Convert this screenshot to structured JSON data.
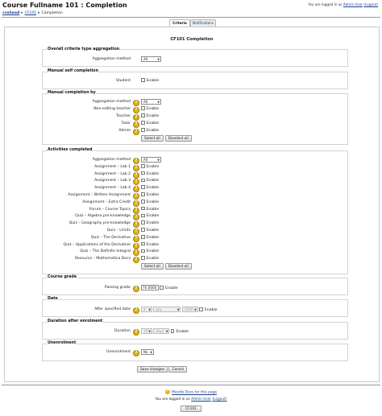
{
  "header": {
    "title": "Course Fullname 101 : Completion",
    "login_prefix": "You are logged in as",
    "login_user": "Admin User",
    "logout": "(Logout)"
  },
  "breadcrumb": [
    "cvshead",
    "CF101",
    "Completion"
  ],
  "tabs": [
    "Criteria",
    "Notifications"
  ],
  "page_title": "CF101 Completion",
  "sections": {
    "aggregation": {
      "legend": "Overall criteria type aggregation",
      "method_label": "Aggregation method",
      "method_value": "All"
    },
    "self": {
      "legend": "Manual self completion",
      "student_label": "Student",
      "enable": "Enable"
    },
    "manual": {
      "legend": "Manual completion by",
      "method_label": "Aggregation method",
      "method_value": "All",
      "roles": [
        "Non-editing teacher",
        "Teacher",
        "Tutor",
        "Admin"
      ],
      "enable": "Enable",
      "select_all": "Select all",
      "deselect_all": "Deselect all"
    },
    "activities": {
      "legend": "Activities completed",
      "method_label": "Aggregation method",
      "method_value": "All",
      "items": [
        "Assignment – Lab 1",
        "Assignment – Lab 2",
        "Assignment – Lab 3",
        "Assignment – Lab 4",
        "Assignment – Written Assignment",
        "Assignment – Extra Credit",
        "Forum – Course Topics",
        "Quiz – Algebra pre-knowledge",
        "Quiz – Geography pre-knowledge",
        "Quiz – Limits",
        "Quiz – The Derivative",
        "Quiz – Applications of the Derivative",
        "Quiz – The Definite Integral",
        "Resource – Mathematica Docs"
      ],
      "enable": "Enable",
      "select_all": "Select all",
      "deselect_all": "Deselect all"
    },
    "grade": {
      "legend": "Course grade",
      "label": "Passing grade",
      "value": "70.0000",
      "enable": "Enable"
    },
    "date": {
      "legend": "Date",
      "label": "After specified date",
      "day": "4",
      "month": "July",
      "year": "2009",
      "enable": "Enable"
    },
    "duration": {
      "legend": "Duration after enrolment",
      "label": "Duration",
      "value": "10",
      "unit": "days",
      "enable": "Enable"
    },
    "unenrolment": {
      "legend": "Unenrolment",
      "label": "Unenrolment",
      "value": "No"
    }
  },
  "actions": {
    "save": "Save changes",
    "cancel": "Cancel"
  },
  "footer": {
    "docs": "Moodle Docs for this page",
    "login_prefix": "You are logged in as",
    "login_user": "Admin User",
    "logout": "(Logout)",
    "home": "CF101"
  }
}
